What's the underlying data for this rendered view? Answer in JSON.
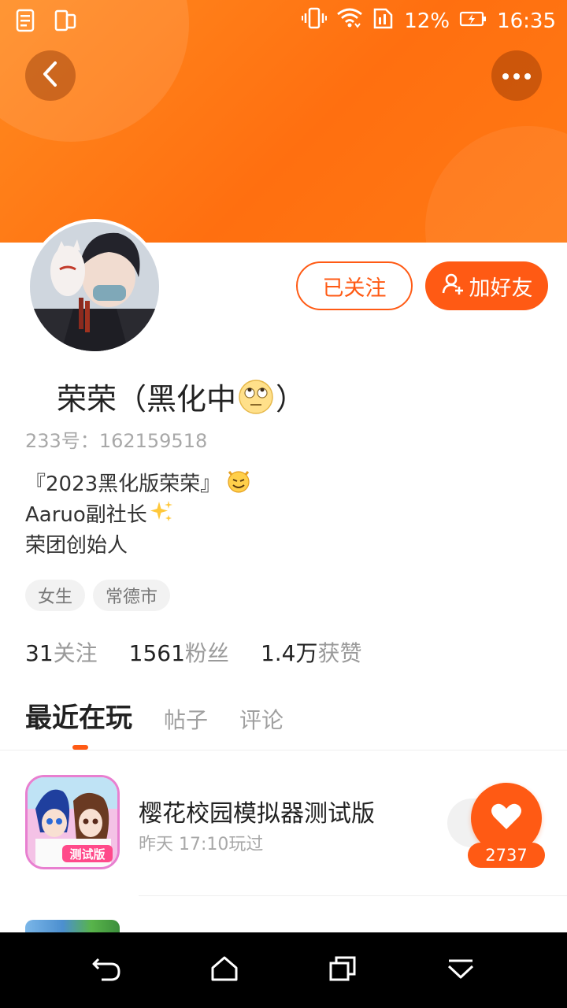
{
  "status_bar": {
    "battery_percent": "12%",
    "time": "16:35"
  },
  "profile": {
    "name_prefix": "荣荣（黑化中",
    "name_suffix": "）",
    "uid_label": "233号：",
    "uid_value": "162159518",
    "bio": {
      "line1": "『2023黑化版荣荣』",
      "line2": "Aaruo副社长",
      "line3": "荣团创始人"
    },
    "tags": [
      "女生",
      "常德市"
    ]
  },
  "actions": {
    "followed_label": "已关注",
    "add_friend_label": "加好友"
  },
  "stats": {
    "following_count": "31",
    "following_label": "关注",
    "fans_count": "1561",
    "fans_label": "粉丝",
    "likes_count": "1.4万",
    "likes_label": "获赞"
  },
  "tabs": {
    "recent": "最近在玩",
    "posts": "帖子",
    "comments": "评论"
  },
  "games": [
    {
      "title": "樱花校园模拟器测试版",
      "last_played": "昨天 17:10玩过",
      "like_count": "2737",
      "icon_badge": "测试版"
    }
  ],
  "colors": {
    "accent": "#ff5a14",
    "banner": "#ff7a14"
  }
}
